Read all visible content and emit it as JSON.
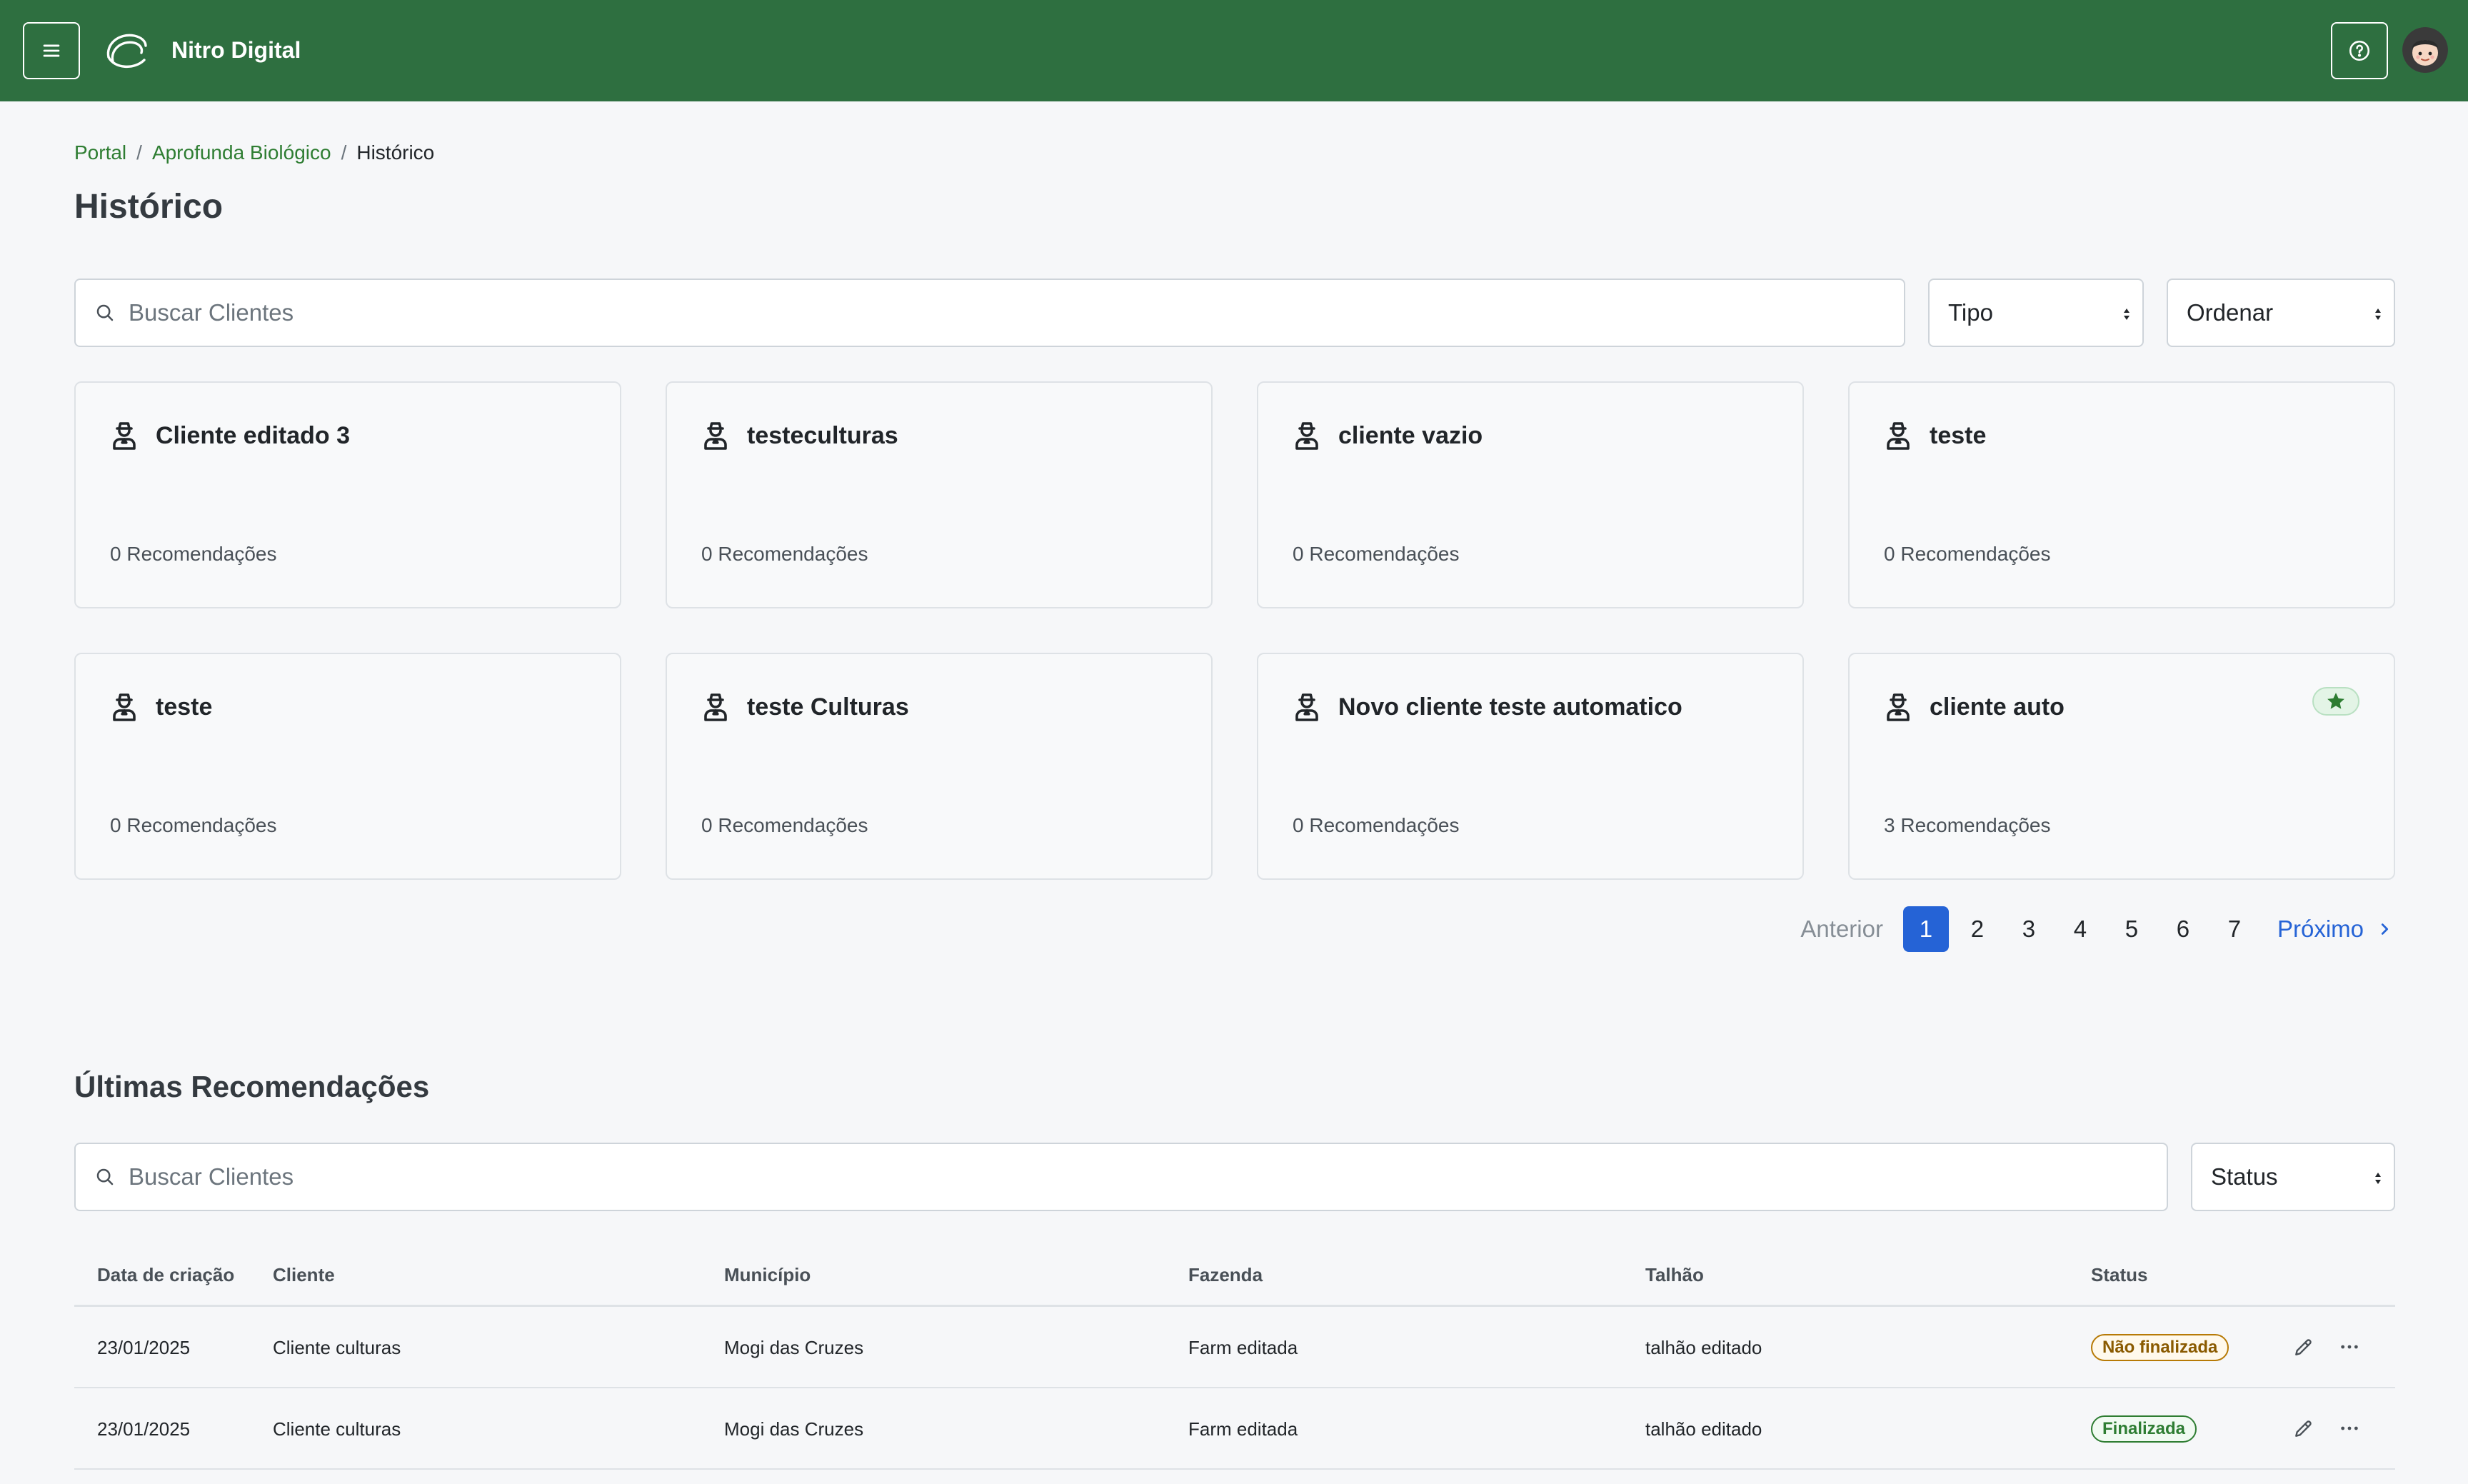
{
  "header": {
    "brand": "Nitro Digital",
    "colors": {
      "bar": "#2e6f40",
      "accent": "#2e7d32",
      "link_blue": "#2563d6"
    },
    "icons": [
      "menu-icon",
      "logo-icon",
      "help-icon",
      "avatar"
    ]
  },
  "breadcrumb": {
    "items": [
      "Portal",
      "Aprofunda Biológico"
    ],
    "separator": "/",
    "current": "Histórico"
  },
  "page": {
    "title": "Histórico"
  },
  "filters": {
    "search_placeholder": "Buscar Clientes",
    "tipo": "Tipo",
    "ordenar": "Ordenar"
  },
  "clients": [
    {
      "name": "Cliente editado 3",
      "recs": "0 Recomendações",
      "favorite": false
    },
    {
      "name": "testeculturas",
      "recs": "0 Recomendações",
      "favorite": false
    },
    {
      "name": "cliente vazio",
      "recs": "0 Recomendações",
      "favorite": false
    },
    {
      "name": "teste",
      "recs": "0 Recomendações",
      "favorite": false
    },
    {
      "name": "teste",
      "recs": "0 Recomendações",
      "favorite": false
    },
    {
      "name": "teste Culturas",
      "recs": "0 Recomendações",
      "favorite": false
    },
    {
      "name": "Novo cliente teste automatico",
      "recs": "0 Recomendações",
      "favorite": false
    },
    {
      "name": "cliente auto",
      "recs": "3 Recomendações",
      "favorite": true
    }
  ],
  "pagination": {
    "prev": "Anterior",
    "pages": [
      "1",
      "2",
      "3",
      "4",
      "5",
      "6",
      "7"
    ],
    "current": "1",
    "next": "Próximo"
  },
  "recommendations": {
    "title": "Últimas Recomendações",
    "search_placeholder": "Buscar Clientes",
    "status_select": "Status",
    "columns": [
      "Data de criação",
      "Cliente",
      "Município",
      "Fazenda",
      "Talhão",
      "Status"
    ],
    "rows": [
      {
        "date": "23/01/2025",
        "client": "Cliente culturas",
        "city": "Mogi das Cruzes",
        "farm": "Farm editada",
        "plot": "talhão editado",
        "status": "Não finalizada",
        "status_kind": "warn"
      },
      {
        "date": "23/01/2025",
        "client": "Cliente culturas",
        "city": "Mogi das Cruzes",
        "farm": "Farm editada",
        "plot": "talhão editado",
        "status": "Finalizada",
        "status_kind": "ok"
      }
    ]
  }
}
